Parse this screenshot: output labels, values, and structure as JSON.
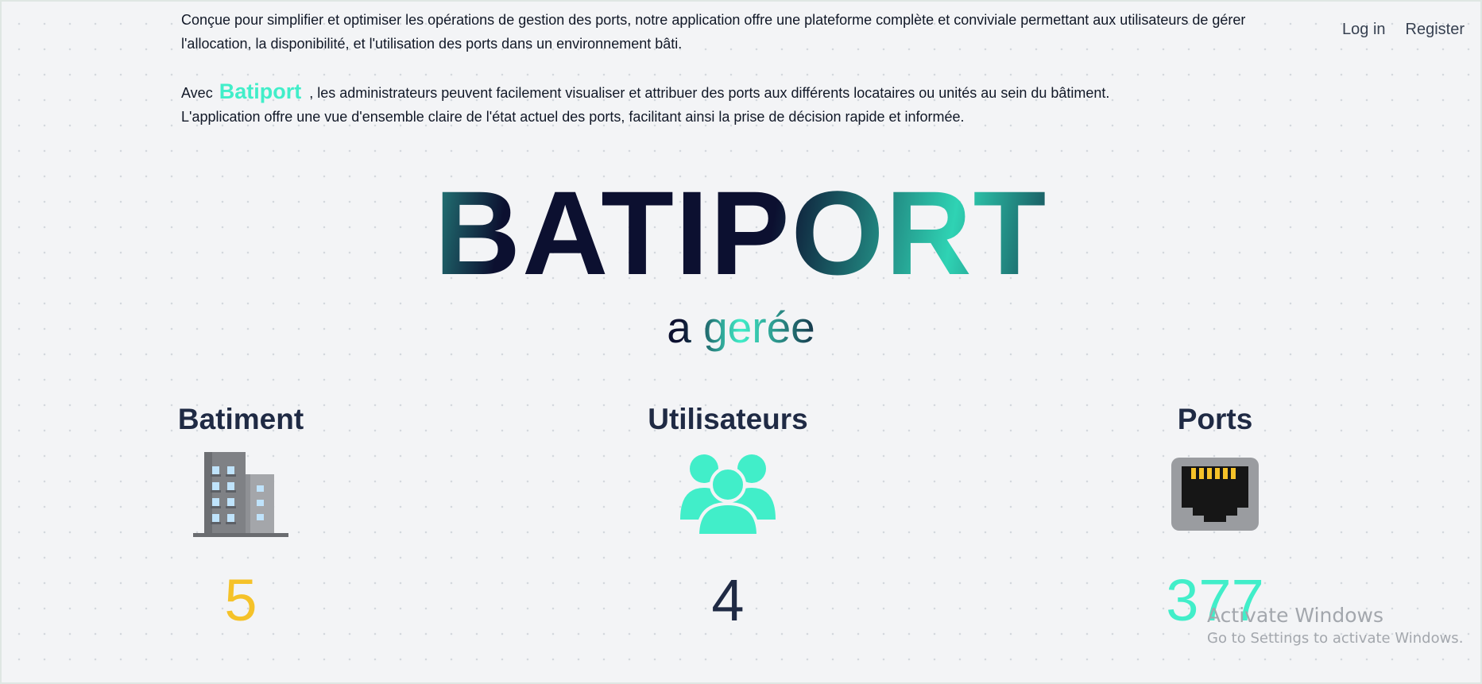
{
  "nav": {
    "login_label": "Log in",
    "register_label": "Register"
  },
  "intro": {
    "paragraph1": "Conçue pour simplifier et optimiser les opérations de gestion des ports, notre application offre une plateforme complète et conviviale permettant aux utilisateurs de gérer l'allocation, la disponibilité, et l'utilisation des ports dans un environnement bâti.",
    "paragraph2_prefix": "Avec",
    "brand": "Batiport",
    "paragraph2_rest": ", les administrateurs peuvent facilement visualiser et attribuer des ports aux différents locataires ou unités au sein du bâtiment.",
    "paragraph2_line2": "L'application offre une vue d'ensemble claire de l'état actuel des ports, facilitant ainsi la prise de décision rapide et informée."
  },
  "hero": {
    "title": "BATIPORT",
    "subtitle": "a gerée"
  },
  "stats": [
    {
      "label": "Batiment",
      "value": "5",
      "icon": "building-icon",
      "color": "#f5c229"
    },
    {
      "label": "Utilisateurs",
      "value": "4",
      "icon": "users-icon",
      "color": "#1f2a44"
    },
    {
      "label": "Ports",
      "value": "377",
      "icon": "ethernet-port-icon",
      "color": "#41eec9"
    }
  ],
  "colors": {
    "accent": "#41eec9",
    "yellow": "#f5c229",
    "dark": "#0c1030"
  },
  "watermark": {
    "line1": "Activate Windows",
    "line2": "Go to Settings to activate Windows."
  }
}
